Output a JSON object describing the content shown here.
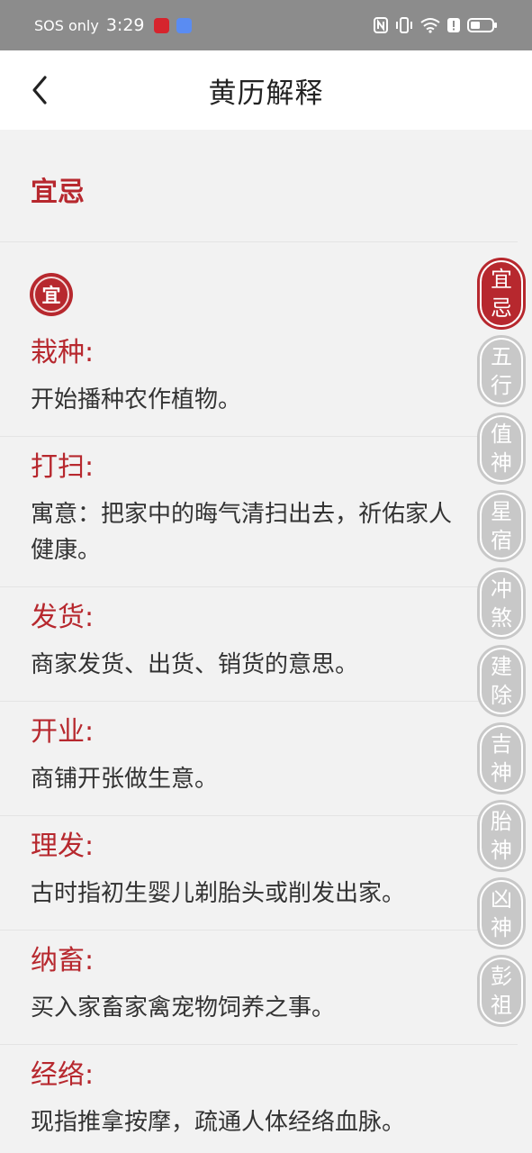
{
  "status_bar": {
    "carrier": "SOS only",
    "time": "3:29"
  },
  "header": {
    "back_icon": "chevron-left-icon",
    "title": "黄历解释"
  },
  "section": {
    "title": "宜忌",
    "seal_char": "宜"
  },
  "entries": [
    {
      "term": "栽种:",
      "desc": "开始播种农作植物。"
    },
    {
      "term": "打扫:",
      "desc": "寓意：把家中的晦气清扫出去，祈佑家人健康。"
    },
    {
      "term": "发货:",
      "desc": "商家发货、出货、销货的意思。"
    },
    {
      "term": "开业:",
      "desc": "商铺开张做生意。"
    },
    {
      "term": "理发:",
      "desc": "古时指初生婴儿剃胎头或削发出家。"
    },
    {
      "term": "纳畜:",
      "desc": "买入家畜家禽宠物饲养之事。"
    },
    {
      "term": "经络:",
      "desc": "现指推拿按摩，疏通人体经络血脉。"
    }
  ],
  "side_nav": [
    {
      "top": "宜",
      "bottom": "忌",
      "active": true
    },
    {
      "top": "五",
      "bottom": "行",
      "active": false
    },
    {
      "top": "值",
      "bottom": "神",
      "active": false
    },
    {
      "top": "星",
      "bottom": "宿",
      "active": false
    },
    {
      "top": "冲",
      "bottom": "煞",
      "active": false
    },
    {
      "top": "建",
      "bottom": "除",
      "active": false
    },
    {
      "top": "吉",
      "bottom": "神",
      "active": false
    },
    {
      "top": "胎",
      "bottom": "神",
      "active": false
    },
    {
      "top": "凶",
      "bottom": "神",
      "active": false
    },
    {
      "top": "彭",
      "bottom": "祖",
      "active": false
    }
  ],
  "colors": {
    "accent": "#b7282e",
    "nav_inactive": "#c8c8c8",
    "background": "#f2f2f2"
  }
}
